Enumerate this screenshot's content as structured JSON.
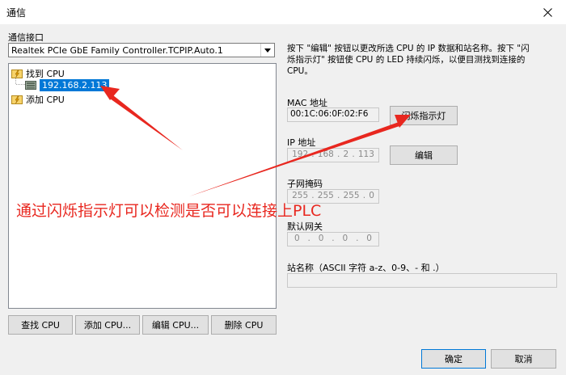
{
  "window": {
    "title": "通信"
  },
  "interface": {
    "label": "通信接口",
    "selected": "Realtek PCIe GbE Family Controller.TCPIP.Auto.1"
  },
  "tree": {
    "nodes": [
      {
        "label": "找到 CPU",
        "icon": "folder-lightning-icon"
      },
      {
        "label": "192.168.2.113",
        "icon": "plc-device-icon",
        "selected": true
      },
      {
        "label": "添加 CPU",
        "icon": "folder-lightning-icon"
      }
    ]
  },
  "buttons": {
    "find_cpu": "查找 CPU",
    "add_cpu": "添加 CPU...",
    "edit_cpu": "编辑 CPU...",
    "delete_cpu": "删除 CPU",
    "flash": "闪烁指示灯",
    "edit": "编辑",
    "ok": "确定",
    "cancel": "取消"
  },
  "description": {
    "line1": "按下 \"编辑\" 按钮以更改所选 CPU 的 IP 数据和站名称。按下 \"闪",
    "line2": "烁指示灯\" 按钮使 CPU 的 LED 持续闪烁，以便目测找到连接的",
    "line3": "CPU。"
  },
  "fields": {
    "mac_label": "MAC 地址",
    "mac_value": "00:1C:06:0F:02:F6",
    "ip_label": "IP 地址",
    "ip_parts": [
      "192",
      "168",
      "2",
      "113"
    ],
    "subnet_label": "子网掩码",
    "subnet_parts": [
      "255",
      "255",
      "255",
      "0"
    ],
    "gateway_label": "默认网关",
    "gateway_parts": [
      "0",
      "0",
      "0",
      "0"
    ],
    "station_label": "站名称（ASCII 字符 a-z、0-9、- 和 .）",
    "station_value": ""
  },
  "annotation": {
    "text": "通过闪烁指示灯可以检测是否可以连接上PLC",
    "color": "#e8271f"
  }
}
